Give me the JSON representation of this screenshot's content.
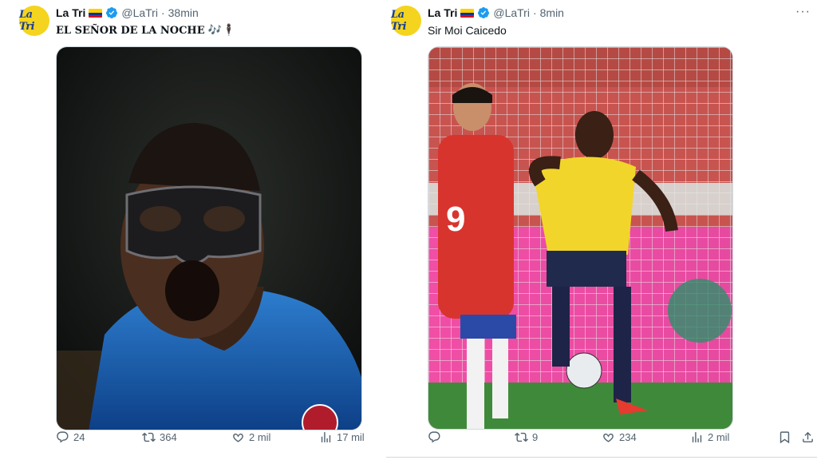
{
  "tweets": [
    {
      "avatar_text": "La Tri",
      "name": "La Tri",
      "handle": "@LaTri",
      "separator": "·",
      "time": "38min",
      "text": "EL SEÑOR DE LA NOCHE",
      "text_emoji": "🎶🕴🏿",
      "media_alt": "Player in protective black face mask shouting in blue jersey",
      "stats": {
        "replies": "24",
        "retweets": "364",
        "likes": "2 mil",
        "views": "17 mil"
      }
    },
    {
      "avatar_text": "La Tri",
      "name": "La Tri",
      "handle": "@LaTri",
      "separator": "·",
      "time": "8min",
      "text": "Sir Moi Caicedo",
      "media_alt": "Ecuador player in yellow celebrating next to Chile player in red number 9",
      "stats": {
        "replies": "",
        "retweets": "9",
        "likes": "234",
        "views": "2 mil"
      },
      "more_label": "···"
    }
  ],
  "colors": {
    "accent": "#1d9bf0",
    "muted": "#536471",
    "avatar_bg": "#f4d41e"
  }
}
